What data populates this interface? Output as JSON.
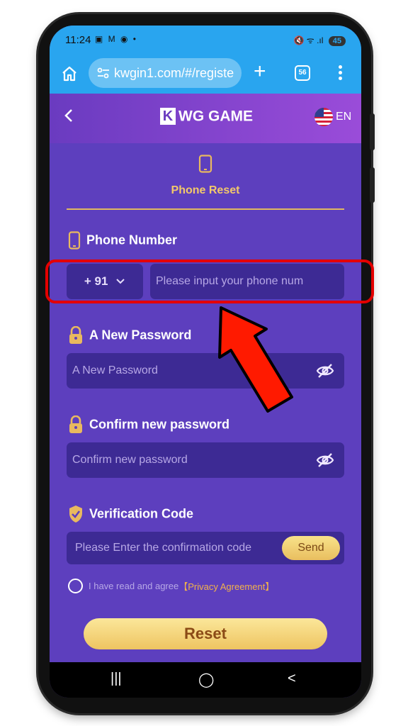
{
  "status_bar": {
    "time": "11:24",
    "notification_icons": "▣ M ◉ •",
    "signal_icons": "🔇 ᯤ .ıl",
    "battery": "45"
  },
  "browser": {
    "home_icon": "home-icon",
    "url": "kwgin1.com/#/registe",
    "tab_count": "56"
  },
  "app_header": {
    "back_icon": "chevron-left-icon",
    "logo_letter": "K",
    "brand": "WG GAME",
    "language": "EN"
  },
  "reset_tab": {
    "label": "Phone Reset"
  },
  "phone": {
    "label": "Phone Number",
    "country_code": "+ 91",
    "placeholder": "Please input your phone num"
  },
  "new_password": {
    "label": "A New Password",
    "placeholder": "A New Password"
  },
  "confirm_password": {
    "label": "Confirm new password",
    "placeholder": "Confirm new password"
  },
  "verification": {
    "label": "Verification Code",
    "placeholder": "Please Enter the confirmation code",
    "send_label": "Send"
  },
  "agreement": {
    "text": "I have read and agree",
    "link": "【Privacy Agreement】"
  },
  "reset_button": "Reset",
  "nav_bar": {
    "recents": "|||",
    "home": "◯",
    "back": "<"
  },
  "colors": {
    "browser_blue": "#29a5ef",
    "app_purple": "#5d3fbe",
    "input_dark": "#3d2a94",
    "gold": "#f2c86a",
    "annotation_red": "#e40000"
  }
}
